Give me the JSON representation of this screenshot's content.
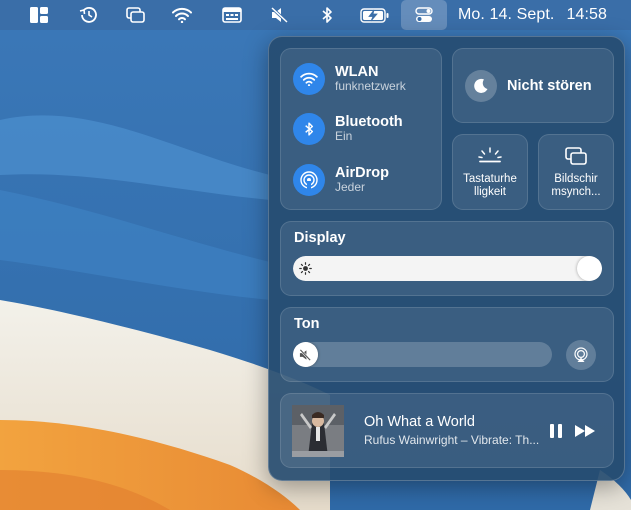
{
  "menubar": {
    "clock_date": "Mo. 14. Sept.",
    "clock_time": "14:58",
    "icons": [
      "window-tiling-icon",
      "time-machine-icon",
      "screen-mirroring-icon",
      "wifi-icon",
      "keyboard-viewer-icon",
      "sound-muted-icon",
      "bluetooth-icon",
      "battery-charging-icon",
      "control-center-icon"
    ]
  },
  "control_center": {
    "wlan": {
      "title": "WLAN",
      "subtitle": "funknetzwerk"
    },
    "bluetooth": {
      "title": "Bluetooth",
      "subtitle": "Ein"
    },
    "airdrop": {
      "title": "AirDrop",
      "subtitle": "Jeder"
    },
    "dnd": {
      "label": "Nicht stören"
    },
    "keyboard_brightness": {
      "line1": "Tastaturhe",
      "line2": "lligkeit"
    },
    "screen_mirroring": {
      "line1": "Bildschir",
      "line2": "msynch..."
    },
    "display": {
      "label": "Display",
      "brightness": 1.0
    },
    "sound": {
      "label": "Ton",
      "volume": 0.0
    },
    "now_playing": {
      "title": "Oh What a World",
      "subtitle": "Rufus Wainwright – Vibrate: Th..."
    }
  },
  "colors": {
    "accent": "#2f86ea",
    "menubar": "#3a6ea8",
    "wallpaper_blue": "#3f7fc0",
    "wallpaper_orange": "#ef9a3c"
  }
}
